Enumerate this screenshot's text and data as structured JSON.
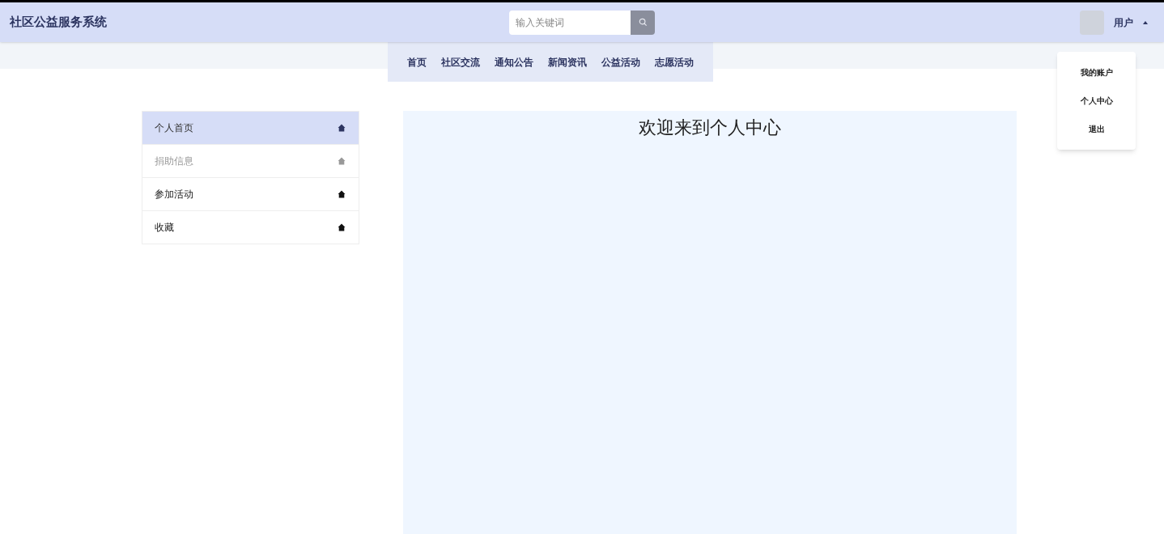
{
  "header": {
    "title": "社区公益服务系统",
    "search": {
      "placeholder": "输入关键词"
    },
    "user": {
      "name": "用户",
      "menu_open": true
    }
  },
  "nav": [
    "首页",
    "社区交流",
    "通知公告",
    "新闻资讯",
    "公益活动",
    "志愿活动"
  ],
  "user_menu": [
    "我的账户",
    "个人中心",
    "退出"
  ],
  "sidebar": [
    {
      "label": "个人首页",
      "selected": true,
      "hovered": false
    },
    {
      "label": "捐助信息",
      "selected": false,
      "hovered": true
    },
    {
      "label": "参加活动",
      "selected": false,
      "hovered": false
    },
    {
      "label": "收藏",
      "selected": false,
      "hovered": false
    }
  ],
  "content": {
    "title": "欢迎来到个人中心"
  }
}
